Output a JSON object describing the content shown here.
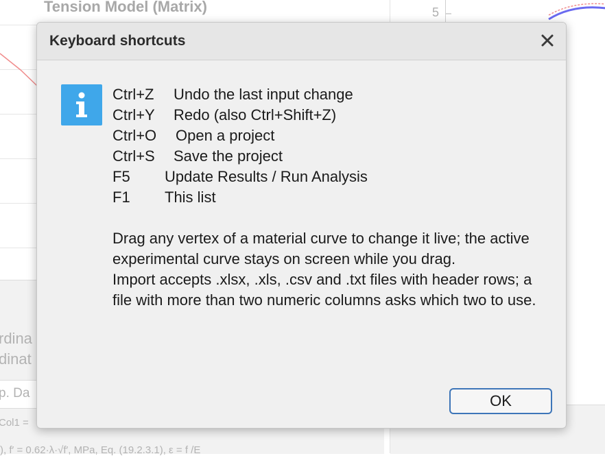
{
  "background": {
    "title": "Tension Model (Matrix)",
    "axis_tick": "5",
    "fragments": {
      "coord_1": "rdina",
      "coord_2": "dinat",
      "exp_data": "p. Da",
      "col_expr": "Col1 =",
      "formula": "), f′ = 0.62·λ·√f′, MPa, Eq. (19.2.3.1), ε = f /E"
    }
  },
  "dialog": {
    "title": "Keyboard shortcuts",
    "close_label": "✕",
    "shortcuts": [
      {
        "key": "Ctrl+Z",
        "desc": "Undo the last input change"
      },
      {
        "key": "Ctrl+Y",
        "desc": "Redo (also Ctrl+Shift+Z)"
      },
      {
        "key": "Ctrl+O",
        "desc": "Open a project"
      },
      {
        "key": "Ctrl+S",
        "desc": "Save the project"
      },
      {
        "key": "F5",
        "desc": "Update Results / Run Analysis"
      },
      {
        "key": "F1",
        "desc": "This list"
      }
    ],
    "paragraph_1": "Drag any vertex of a material curve to change it live; the active experimental curve stays on screen while you drag.",
    "paragraph_2": "Import accepts .xlsx, .xls, .csv and .txt files with header rows; a file with more than two numeric columns asks which two to use.",
    "ok_label": "OK"
  },
  "colors": {
    "info_icon": "#3fa7ea",
    "ok_border": "#3d75b8",
    "curve_red": "#f08c8c",
    "curve_blue": "#6a6af0"
  },
  "icons": {
    "info": "info-icon",
    "close": "close-icon"
  }
}
